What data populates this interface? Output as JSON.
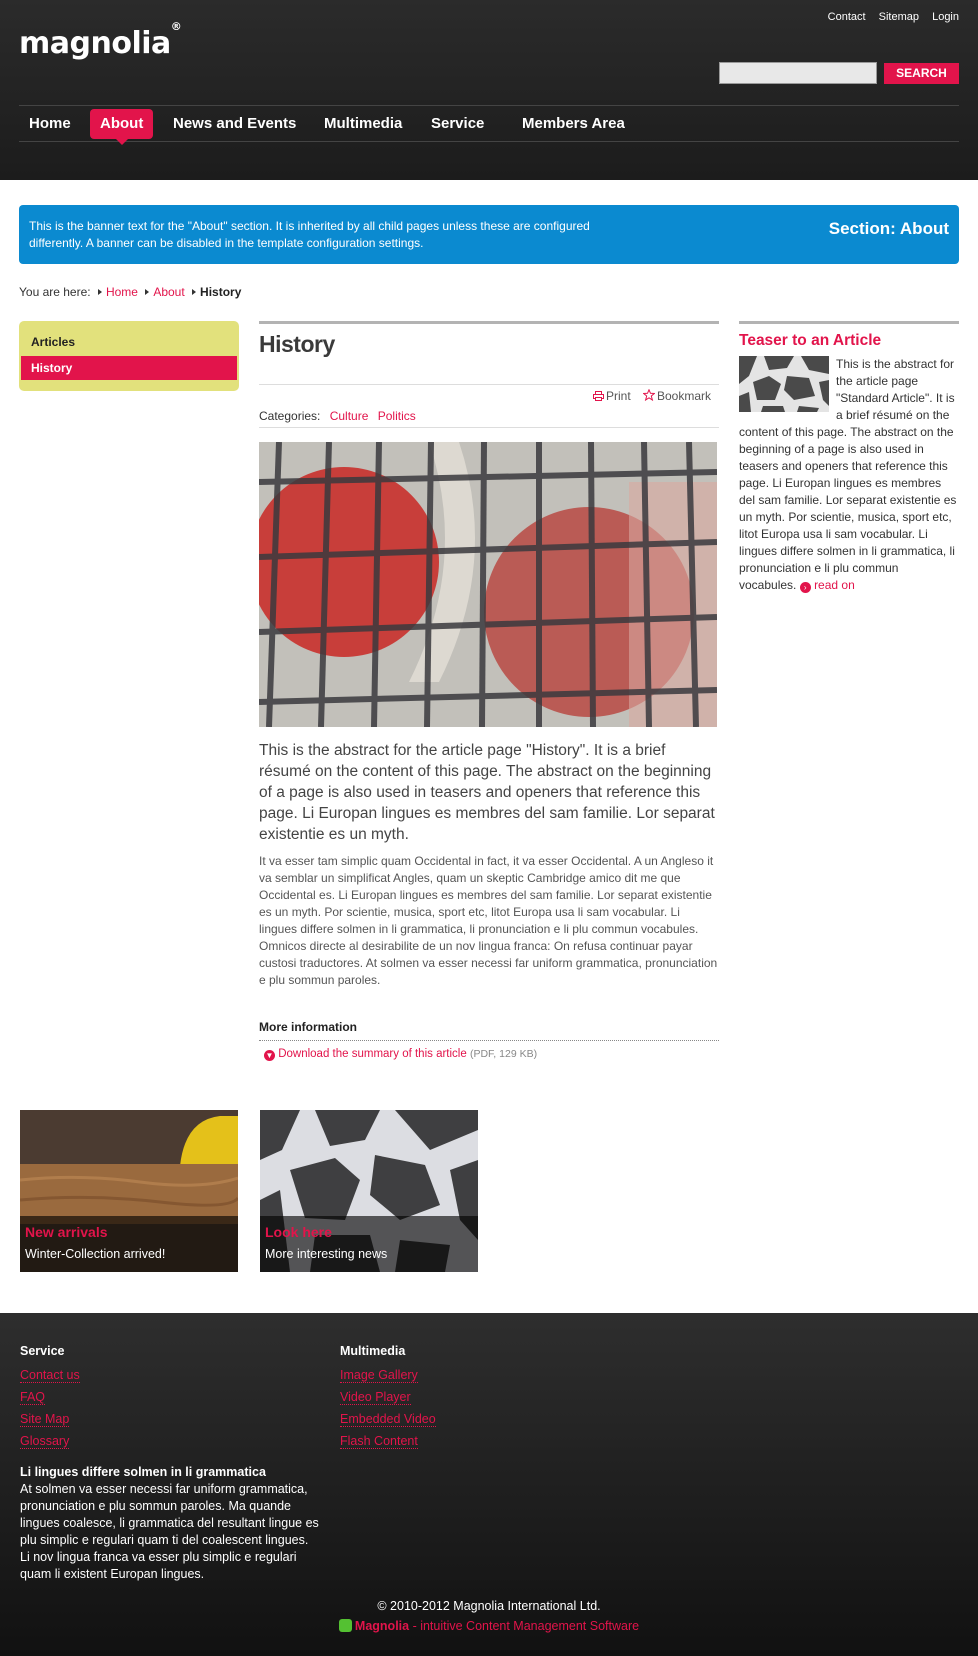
{
  "header": {
    "logo_text": "magnolia",
    "logo_mark": "®",
    "top_links": [
      "Contact",
      "Sitemap",
      "Login"
    ],
    "search": {
      "placeholder": "",
      "button_label": "SEARCH"
    },
    "nav": [
      {
        "label": "Home",
        "active": false
      },
      {
        "label": "About",
        "active": true
      },
      {
        "label": "News and Events",
        "active": false
      },
      {
        "label": "Multimedia",
        "active": false
      },
      {
        "label": "Service",
        "active": false
      },
      {
        "label": "Members Area",
        "active": false
      }
    ]
  },
  "banner": {
    "text": "This is the banner text for the \"About\" section. It is inherited by all child pages unless these are configured differently. A banner can be disabled in the template configuration settings.",
    "section": "Section: About"
  },
  "breadcrumb": {
    "prefix": "You are here:",
    "items": [
      "Home",
      "About"
    ],
    "current": "History"
  },
  "subnav": {
    "title": "Articles",
    "active_item": "History"
  },
  "article": {
    "title": "History",
    "tools": {
      "print": "Print",
      "bookmark": "Bookmark"
    },
    "categories_label": "Categories:",
    "categories": [
      "Culture",
      "Politics"
    ],
    "abstract": "This is the abstract for the article page \"History\". It is a brief résumé on the content of this page. The abstract on the beginning of a page is also used in teasers and openers that reference this page. Li Europan lingues es membres del sam familie. Lor separat existentie es un myth.",
    "body": "It va esser tam simplic quam Occidental in fact, it va esser Occidental. A un Angleso it va semblar un simplificat Angles, quam un skeptic Cambridge amico dit me que Occidental es. Li Europan lingues es membres del sam familie. Lor separat existentie es un myth. Por scientie, musica, sport etc, litot Europa usa li sam vocabular. Li lingues differe solmen in li grammatica, li pronunciation e li plu commun vocabules. Omnicos directe al desirabilite de un nov lingua franca: On refusa continuar payar custosi traductores. At solmen va esser necessi far uniform grammatica, pronunciation e plu sommun paroles.",
    "more_info_title": "More information",
    "download_label": "Download the summary of this article",
    "download_meta": "(PDF, 129 KB)"
  },
  "teaser": {
    "title": "Teaser to an Article",
    "text": "This is the abstract for the article page \"Standard Article\". It is a brief résumé on the content of this page. The abstract on the beginning of a page is also used in teasers and openers that reference this page. Li Europan lingues es membres del sam familie. Lor separat existentie es un myth. Por scientie, musica, sport etc, litot Europa usa li sam vocabular. Li lingues differe solmen in li grammatica, li pronunciation e li plu commun vocabules.",
    "read_on": "read on"
  },
  "promos": [
    {
      "title": "New arrivals",
      "subtitle": "Winter-Collection arrived!"
    },
    {
      "title": "Look here",
      "subtitle": "More interesting news"
    }
  ],
  "footer": {
    "columns": [
      {
        "title": "Service",
        "links": [
          "Contact us",
          "FAQ",
          "Site Map",
          "Glossary"
        ]
      },
      {
        "title": "Multimedia",
        "links": [
          "Image Gallery",
          "Video Player",
          "Embedded Video",
          "Flash Content"
        ]
      }
    ],
    "para_title": "Li lingues differe solmen in li grammatica",
    "para_text": "At solmen va esser necessi far uniform grammatica, pronunciation e plu sommun paroles. Ma quande lingues coalesce, li grammatica del resultant lingue es plu simplic e regulari quam ti del coalescent lingues. Li nov lingua franca va esser plu simplic e regulari quam li existent Europan lingues.",
    "copyright": "© 2010-2012 Magnolia International Ltd.",
    "powered_brand": "Magnolia",
    "powered_text": " - intuitive Content Management Software"
  },
  "colors": {
    "accent": "#e2144b",
    "banner": "#0b8ad0",
    "subnav": "#e2e17c",
    "header": "#222222"
  }
}
